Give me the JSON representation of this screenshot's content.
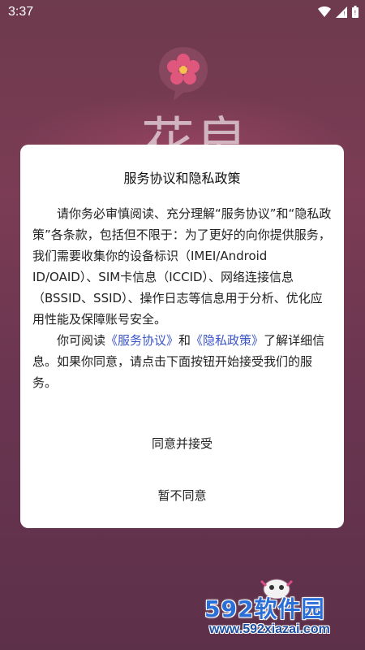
{
  "status_bar": {
    "time": "3:37",
    "icons": [
      "wifi-icon",
      "signal-icon",
      "battery-icon"
    ]
  },
  "background": {
    "title_partial": "花良"
  },
  "dialog": {
    "title": "服务协议和隐私政策",
    "para1": "请你务必审慎阅读、充分理解“服务协议”和“隐私政策”各条款，包括但不限于：为了更好的向你提供服务，我们需要收集你的设备标识（IMEI/Android ID/OAID）、SIM卡信息（ICCID）、网络连接信息（BSSID、SSID）、操作日志等信息用于分析、优化应用性能及保障账号安全。",
    "para2_prefix": "你可阅读",
    "link_service": "《服务协议》",
    "para2_and": "和",
    "link_privacy": "《隐私政策》",
    "para2_suffix": "了解详细信息。如果你同意，请点击下面按钮开始接受我们的服务。",
    "agree_label": "同意并接受",
    "decline_label": "暂不同意"
  },
  "watermark": {
    "brand": "592软件园",
    "url": "www.592xiazai.com"
  },
  "colors": {
    "link": "#3b55c7",
    "background": "#6e3a4d",
    "watermark_brand": "#2a6fd8"
  }
}
